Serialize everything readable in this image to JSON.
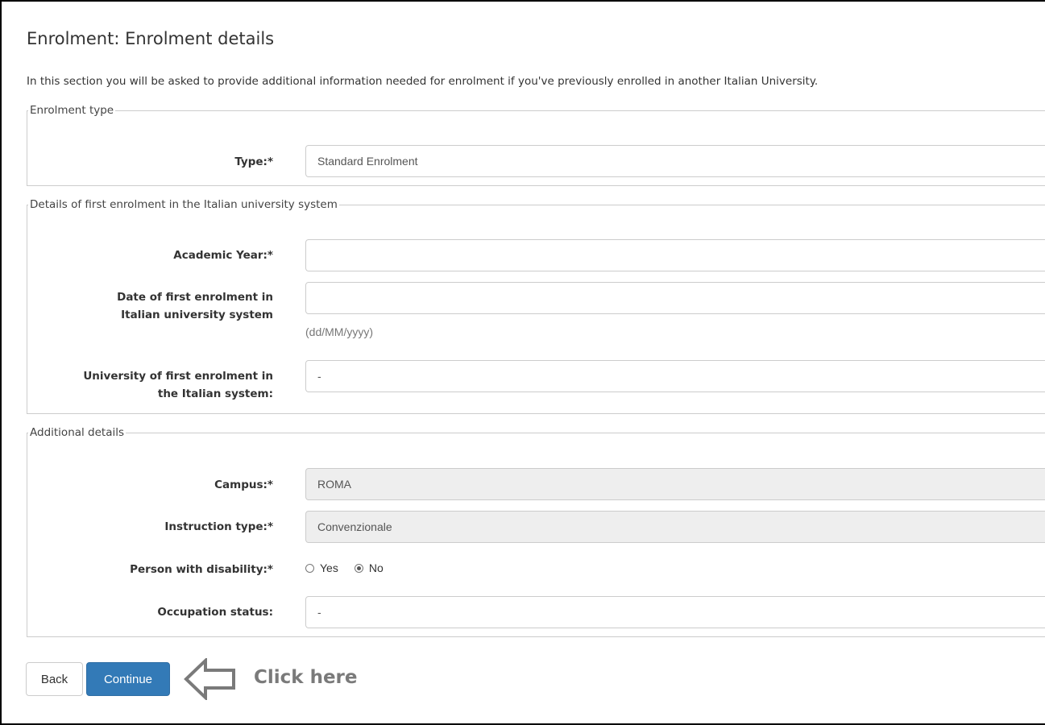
{
  "page": {
    "title": "Enrolment: Enrolment details",
    "intro": "In this section you will be asked to provide additional information needed for enrolment if you've previously enrolled in another Italian University."
  },
  "enrolment_type": {
    "legend": "Enrolment type",
    "type_label": "Type:*",
    "type_value": "Standard Enrolment"
  },
  "first_enrolment": {
    "legend": "Details of first enrolment in the Italian university system",
    "academic_year_label": "Academic Year:*",
    "academic_year_value": "",
    "date_label_line1": "Date of first enrolment in",
    "date_label_line2": "Italian university system",
    "date_value": "",
    "date_hint": "(dd/MM/yyyy)",
    "university_label_line1": "University of first enrolment in",
    "university_label_line2": "the Italian system:",
    "university_value": "-"
  },
  "additional": {
    "legend": "Additional details",
    "campus_label": "Campus:*",
    "campus_value": "ROMA",
    "instruction_label": "Instruction type:*",
    "instruction_value": "Convenzionale",
    "disability_label": "Person with disability:*",
    "disability_options": [
      "Yes",
      "No"
    ],
    "disability_selected": "No",
    "occupation_label": "Occupation status:",
    "occupation_value": "-"
  },
  "actions": {
    "back_label": "Back",
    "continue_label": "Continue",
    "annotation": "Click here"
  },
  "colors": {
    "primary_button": "#337ab7",
    "readonly_field": "#eeeeee",
    "annotation": "#7a7a7a"
  }
}
